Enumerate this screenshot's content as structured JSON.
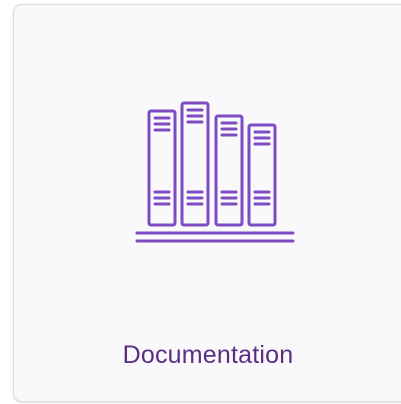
{
  "card": {
    "title": "Documentation",
    "icon": "books-on-shelf-icon"
  },
  "colors": {
    "accent": "#7e4cc2",
    "label": "#5b2d83",
    "card_background": "#f9f9fb"
  }
}
